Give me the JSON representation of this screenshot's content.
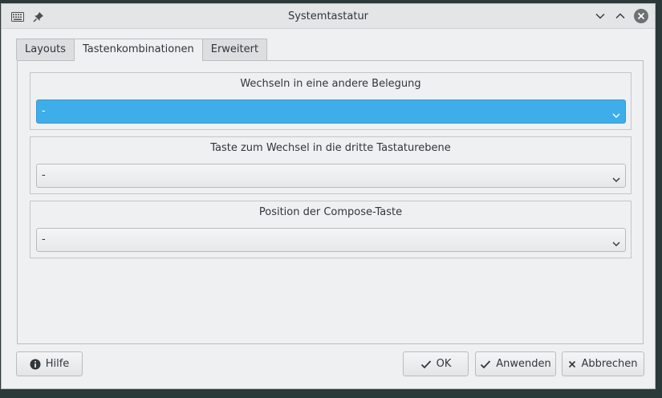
{
  "window": {
    "title": "Systemtastatur"
  },
  "tabs": [
    {
      "label": "Layouts",
      "active": false
    },
    {
      "label": "Tastenkombinationen",
      "active": true
    },
    {
      "label": "Erweitert",
      "active": false
    }
  ],
  "groups": [
    {
      "title": "Wechseln in eine andere Belegung",
      "value": "-",
      "highlighted": true
    },
    {
      "title": "Taste zum Wechsel in die dritte Tastaturebene",
      "value": "-",
      "highlighted": false
    },
    {
      "title": "Position der Compose-Taste",
      "value": "-",
      "highlighted": false
    }
  ],
  "buttons": {
    "help": "Hilfe",
    "ok": "OK",
    "apply": "Anwenden",
    "cancel": "Abbrechen"
  },
  "colors": {
    "accent": "#3daee9",
    "background": "#eff0f1",
    "text": "#31363b"
  },
  "icons": {
    "titlebar_left": [
      "keyboard-icon",
      "pin-icon"
    ],
    "titlebar_right": [
      "minimize-icon",
      "maximize-icon",
      "close-icon"
    ],
    "help": "info-icon",
    "ok": "check-icon",
    "apply": "check-icon",
    "cancel": "x-icon"
  }
}
